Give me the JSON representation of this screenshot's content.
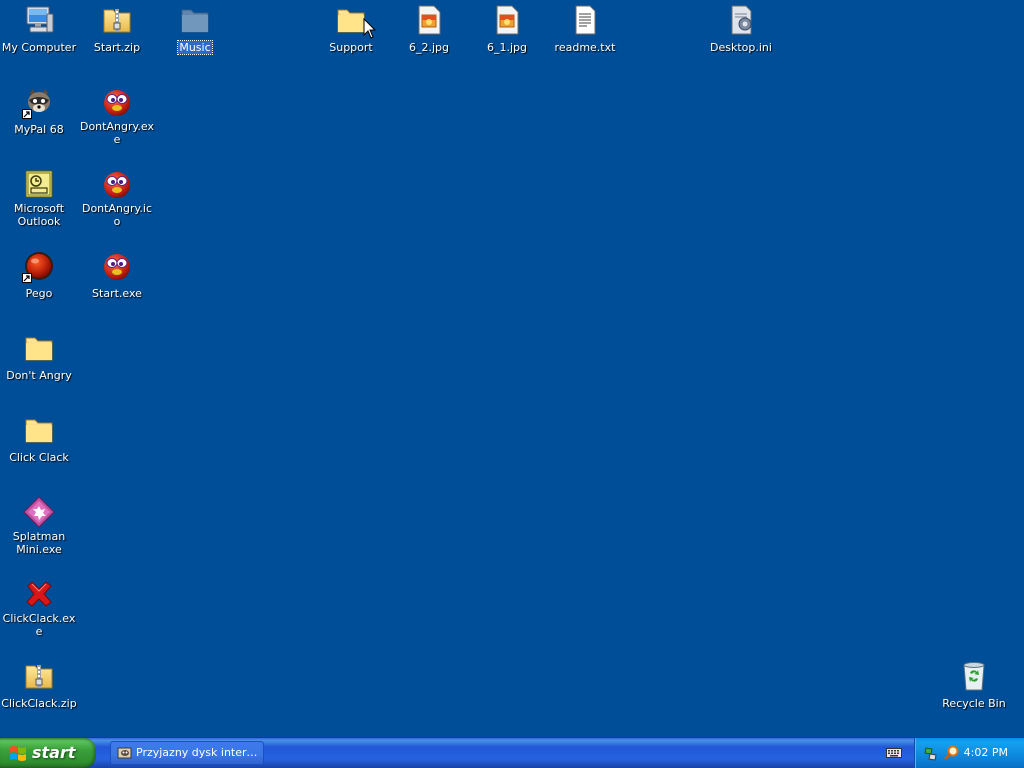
{
  "desktop": {
    "background_color": "#004e98",
    "icons": {
      "my_computer": {
        "label": "My Computer",
        "icon": "computer-icon"
      },
      "start_zip": {
        "label": "Start.zip",
        "icon": "zip-folder-icon"
      },
      "music": {
        "label": "Music",
        "icon": "folder-icon",
        "selected": true
      },
      "support": {
        "label": "Support",
        "icon": "folder-icon"
      },
      "img_6_2": {
        "label": "6_2.jpg",
        "icon": "jpg-file-icon"
      },
      "img_6_1": {
        "label": "6_1.jpg",
        "icon": "jpg-file-icon"
      },
      "readme": {
        "label": "readme.txt",
        "icon": "text-file-icon"
      },
      "desktop_ini": {
        "label": "Desktop.ini",
        "icon": "ini-file-icon"
      },
      "mypal": {
        "label": "MyPal 68",
        "icon": "raccoon-icon"
      },
      "dontangry_exe": {
        "label": "DontAngry.exe",
        "icon": "red-ball-icon"
      },
      "outlook": {
        "label": "Microsoft Outlook",
        "icon": "outlook-icon"
      },
      "dontangry_ico": {
        "label": "DontAngry.ico",
        "icon": "red-ball-icon"
      },
      "pego": {
        "label": "Pego",
        "icon": "pego-icon"
      },
      "start_exe": {
        "label": "Start.exe",
        "icon": "red-ball-icon"
      },
      "dont_angry": {
        "label": "Don't Angry",
        "icon": "folder-icon"
      },
      "click_clack": {
        "label": "Click Clack",
        "icon": "folder-icon"
      },
      "splatman": {
        "label": "Splatman Mini.exe",
        "icon": "splatman-icon"
      },
      "clickclack_exe": {
        "label": "ClickClack.exe",
        "icon": "red-x-icon"
      },
      "clickclack_zip": {
        "label": "ClickClack.zip",
        "icon": "zip-folder-icon"
      },
      "recycle_bin": {
        "label": "Recycle Bin",
        "icon": "recycle-bin-icon"
      }
    }
  },
  "taskbar": {
    "start_label": "start",
    "task_label": "Przyjazny dysk intern...",
    "clock": "4:02 PM"
  },
  "colors": {
    "taskbar_blue": "#2663e0",
    "start_green": "#3aa13a",
    "tray_blue": "#0d88de",
    "selection_blue": "#316ac5"
  }
}
